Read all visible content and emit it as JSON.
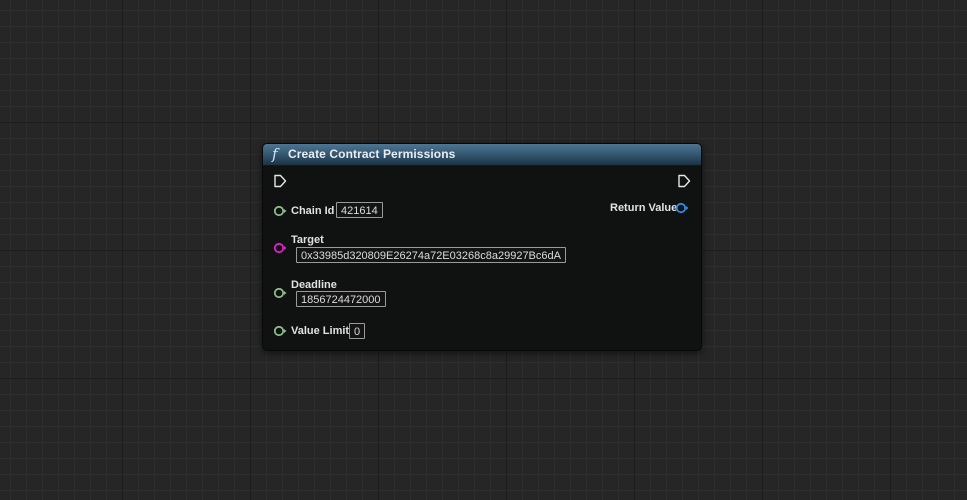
{
  "node": {
    "icon": "function-f-icon",
    "icon_glyph": "f",
    "title": "Create Contract Permissions",
    "header_color": "#3f6682"
  },
  "pins": {
    "exec_in": {
      "icon": "exec-triangle-icon"
    },
    "exec_out": {
      "icon": "exec-triangle-icon"
    },
    "chain_id": {
      "label": "Chain Id",
      "value": "421614",
      "color": "#8fb98a"
    },
    "target": {
      "label": "Target",
      "value": "0x33985d320809E26274a72E03268c8a29927Bc6dA",
      "color": "#e020c8"
    },
    "deadline": {
      "label": "Deadline",
      "value": "1856724472000",
      "color": "#8fb98a"
    },
    "value_limit": {
      "label": "Value Limit",
      "value": "0",
      "color": "#8fb98a"
    },
    "return_value": {
      "label": "Return Value",
      "color": "#2a8de8"
    }
  }
}
